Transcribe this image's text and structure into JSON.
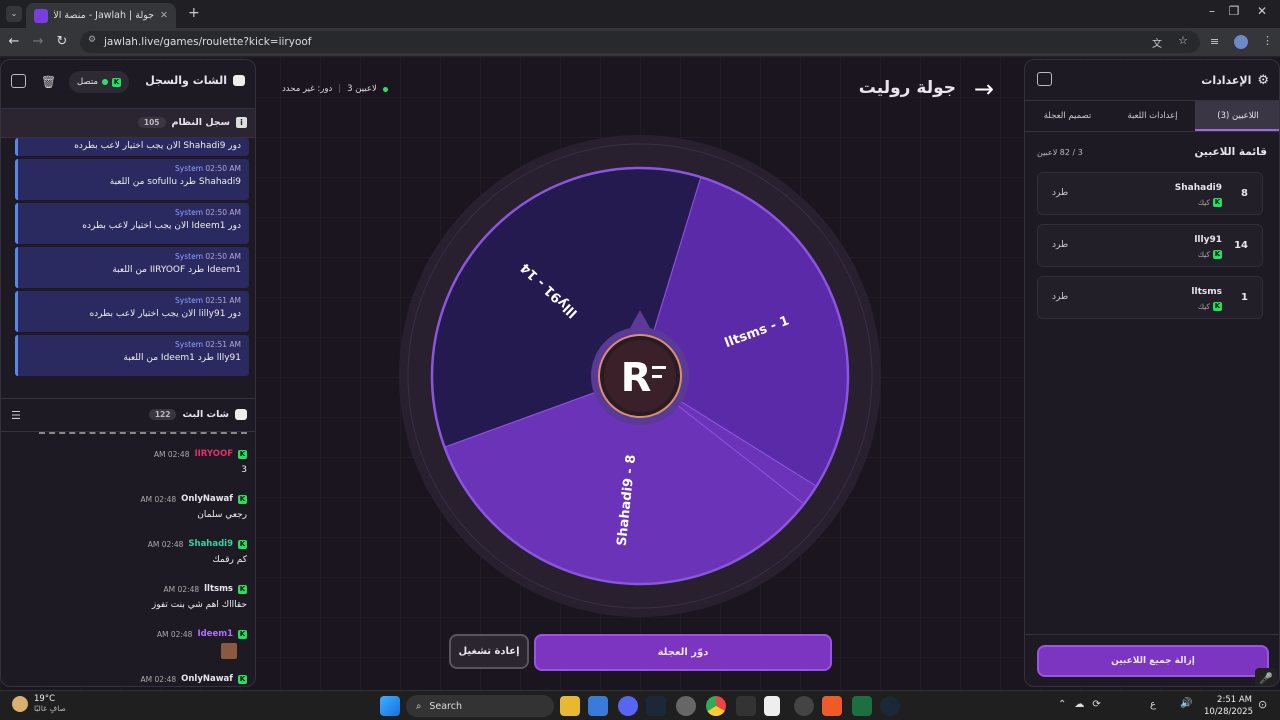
{
  "browser": {
    "tab_title": "جولة | Jawlah - منصة الألعاب الت...",
    "url": "jawlah.live/games/roulette?kick=iiryoof"
  },
  "left": {
    "title": "الشات والسجل",
    "status": "متصل",
    "syslog_title": "سجل النظام",
    "syslog_count": "105",
    "first_line": "دور Shahadi9 الان يجب اختيار لاعب بطرده",
    "logs": [
      {
        "who": "System",
        "time": "02:50 AM",
        "msg": "Shahadi9 طرد sofullu من اللعبة"
      },
      {
        "who": "System",
        "time": "02:50 AM",
        "msg": "دور Ideem1 الان يجب اختيار لاعب بطرده"
      },
      {
        "who": "System",
        "time": "02:50 AM",
        "msg": "Ideem1 طرد IIRYOOF من اللعبة"
      },
      {
        "who": "System",
        "time": "02:51 AM",
        "msg": "دور lilly91 الان يجب اختيار لاعب بطرده"
      },
      {
        "who": "System",
        "time": "02:51 AM",
        "msg": "llly91 طرد Ideem1 من اللعبة"
      }
    ],
    "chat_title": "شات البث",
    "chat_count": "122",
    "chats": [
      {
        "user": "IIRYOOF",
        "color": "#e0306a",
        "time": "02:48 AM",
        "msg": "3"
      },
      {
        "user": "OnlyNawaf",
        "color": "#e8e4f0",
        "time": "02:48 AM",
        "msg": "رجعي سلمان"
      },
      {
        "user": "Shahadi9",
        "color": "#35d4a0",
        "time": "02:48 AM",
        "msg": "كم رقمك"
      },
      {
        "user": "lltsms",
        "color": "#e8e4f0",
        "time": "02:48 AM",
        "msg": "حقاااك اهم شي بنت تفوز"
      },
      {
        "user": "Ideem1",
        "color": "#b070ff",
        "time": "02:48 AM",
        "msg": ""
      },
      {
        "user": "OnlyNawaf",
        "color": "#e8e4f0",
        "time": "02:48 AM",
        "msg": ""
      }
    ]
  },
  "center": {
    "title": "جولة روليت",
    "players_count": "3 لاعبين",
    "turn": "دور: غير محدد",
    "spin": "دوّر العجلة",
    "restart": "إعادة تشغيل",
    "logo": "R"
  },
  "wheel": {
    "segments": [
      {
        "label": "lltsms - 1",
        "value": 1,
        "color": "#5a2aa8"
      },
      {
        "label": "Shahadi9 - 8",
        "value": 8,
        "color": "#6a33b8"
      },
      {
        "label": "llly91 - 14",
        "value": 14,
        "color": "#241a50"
      }
    ]
  },
  "right": {
    "title": "الإعدادات",
    "tabs": [
      "اللاعبين (3)",
      "إعدادات اللعبة",
      "تصميم العجلة"
    ],
    "list_title": "قائمة اللاعبين",
    "list_count": "3 / 82 لاعبين",
    "players": [
      {
        "num": "8",
        "name": "Shahadi9",
        "source": "كيك",
        "kick": "طرد"
      },
      {
        "num": "14",
        "name": "llly91",
        "source": "كيك",
        "kick": "طرد"
      },
      {
        "num": "1",
        "name": "lltsms",
        "source": "كيك",
        "kick": "طرد"
      }
    ],
    "remove_all": "إزالة جميع اللاعبين"
  },
  "taskbar": {
    "weather_temp": "19°C",
    "weather_desc": "صافٍ غالبًا",
    "search": "Search",
    "time": "2:51 AM",
    "date": "10/28/2025",
    "lang": "ع"
  }
}
